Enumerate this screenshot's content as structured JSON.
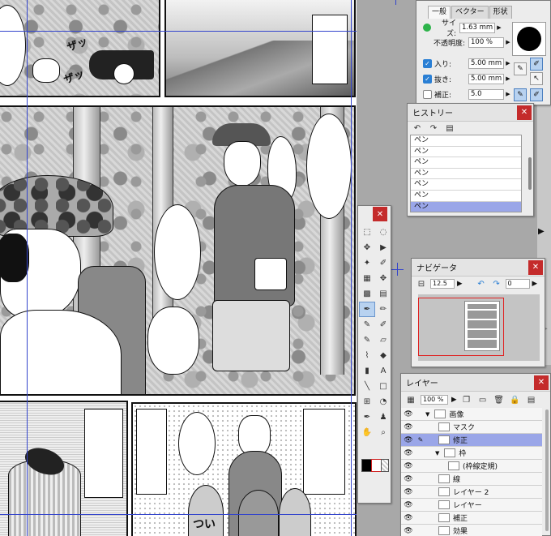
{
  "canvas": {
    "sfx": [
      "ザッ",
      "ザッ"
    ],
    "sign_text": "つい"
  },
  "tool_property": {
    "tabs": [
      "一般",
      "ベクター",
      "形状"
    ],
    "rows": [
      {
        "label": "サイズ:",
        "value": "1.63 mm"
      },
      {
        "label": "不透明度:",
        "value": "100 %"
      },
      {
        "label": "入り:",
        "value": "5.00 mm"
      },
      {
        "label": "抜き:",
        "value": "5.00 mm"
      },
      {
        "label": "補正:",
        "value": "5.0"
      }
    ]
  },
  "history": {
    "title": "ヒストリー",
    "items": [
      "ペン",
      "ペン",
      "ペン",
      "ペン",
      "ペン",
      "ペン",
      "ペン"
    ],
    "selected_index": 6
  },
  "navigator": {
    "title": "ナビゲータ",
    "zoom": "12.5",
    "rotation": "0"
  },
  "layer": {
    "title": "レイヤー",
    "opacity": "100 %",
    "rows": [
      {
        "name": "画像",
        "indent": 0,
        "selected": false
      },
      {
        "name": "マスク",
        "indent": 1,
        "selected": false
      },
      {
        "name": "修正",
        "indent": 1,
        "selected": true
      },
      {
        "name": "枠",
        "indent": 1,
        "selected": false
      },
      {
        "name": "(枠線定規)",
        "indent": 2,
        "selected": false
      },
      {
        "name": "線",
        "indent": 1,
        "selected": false
      },
      {
        "name": "レイヤー 2",
        "indent": 1,
        "selected": false
      },
      {
        "name": "レイヤー",
        "indent": 1,
        "selected": false
      },
      {
        "name": "補正",
        "indent": 1,
        "selected": false
      },
      {
        "name": "効果",
        "indent": 1,
        "selected": false
      }
    ]
  },
  "colors": {
    "accent": "#9aa6e8",
    "close": "#c42b2b",
    "main_color": "#000000",
    "sub_color": "#ffffff"
  }
}
